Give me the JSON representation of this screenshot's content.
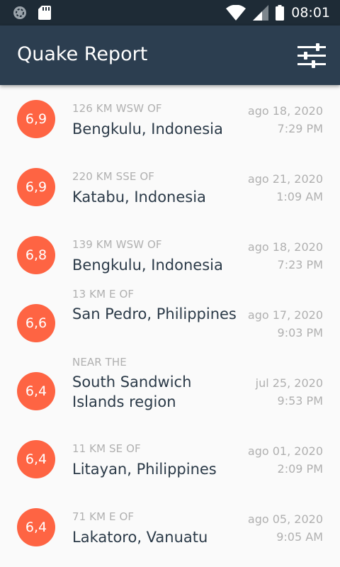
{
  "status_bar": {
    "time": "08:01",
    "icons": [
      "sync-icon",
      "sd-card-icon",
      "wifi-icon",
      "cell-signal-icon",
      "battery-icon"
    ]
  },
  "app_bar": {
    "title": "Quake Report",
    "filter_icon": "sliders-icon"
  },
  "colors": {
    "status_bar": "#1e2b36",
    "app_bar": "#2c3e50",
    "magnitude_circle": "#fe6443",
    "primary_text": "#2b3a48",
    "secondary_text": "#b0b0b0"
  },
  "earthquakes": [
    {
      "magnitude": "6,9",
      "location_offset": "126 km WSW of",
      "primary_location": "Bengkulu, Indonesia",
      "date": "ago 18, 2020",
      "time": "7:29 PM"
    },
    {
      "magnitude": "6,9",
      "location_offset": "220 km SSE of",
      "primary_location": "Katabu, Indonesia",
      "date": "ago 21, 2020",
      "time": "1:09 AM"
    },
    {
      "magnitude": "6,8",
      "location_offset": "139 km WSW of",
      "primary_location": "Bengkulu, Indonesia",
      "date": "ago 18, 2020",
      "time": "7:23 PM"
    },
    {
      "magnitude": "6,6",
      "location_offset": "13 km E of",
      "primary_location": "San Pedro, Philippines",
      "date": "ago 17, 2020",
      "time": "9:03 PM"
    },
    {
      "magnitude": "6,4",
      "location_offset": "Near the",
      "primary_location": "South Sandwich Islands region",
      "date": "jul 25, 2020",
      "time": "9:53 PM"
    },
    {
      "magnitude": "6,4",
      "location_offset": "11 km SE of",
      "primary_location": "Litayan, Philippines",
      "date": "ago 01, 2020",
      "time": "2:09 PM"
    },
    {
      "magnitude": "6,4",
      "location_offset": "71 km E of",
      "primary_location": "Lakatoro, Vanuatu",
      "date": "ago 05, 2020",
      "time": "9:05 AM"
    }
  ]
}
